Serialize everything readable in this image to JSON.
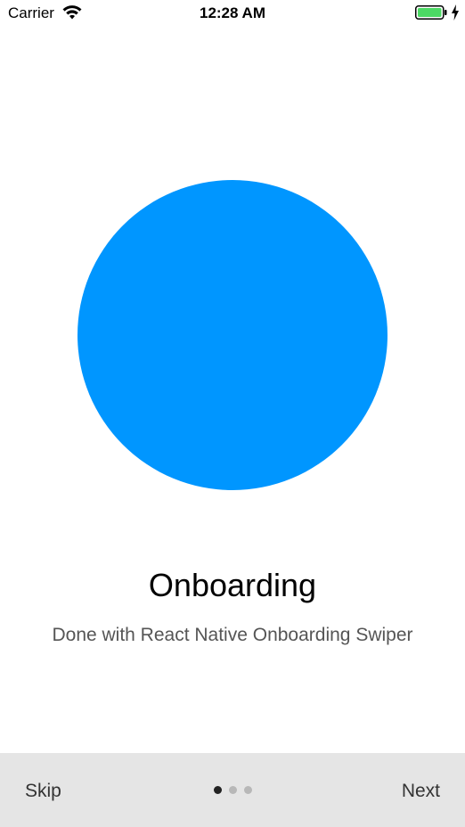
{
  "status_bar": {
    "carrier": "Carrier",
    "time": "12:28 AM",
    "wifi_icon": "wifi-icon",
    "battery_icon": "battery-icon",
    "charging_icon": "charging-bolt-icon",
    "battery_color": "#4cd964"
  },
  "slide": {
    "title": "Onboarding",
    "subtitle": "Done with React Native Onboarding Swiper",
    "image_color": "#0096ff"
  },
  "bottom_bar": {
    "skip_label": "Skip",
    "next_label": "Next",
    "page_count": 3,
    "active_page": 1,
    "background": "#e5e5e5"
  }
}
